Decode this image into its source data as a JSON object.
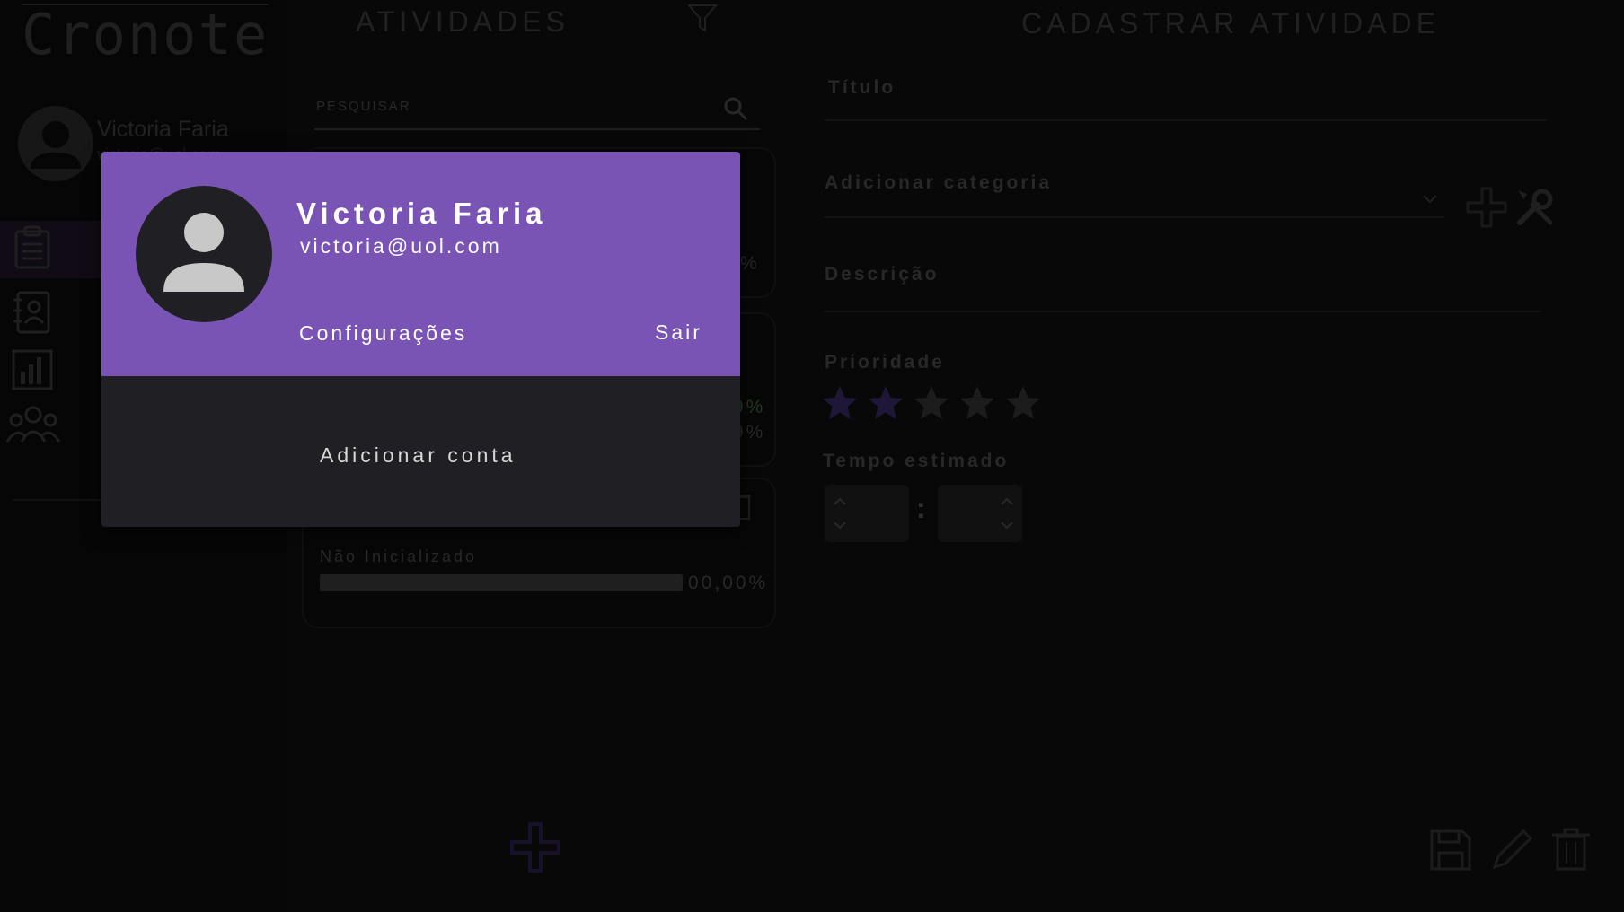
{
  "app": {
    "logo": "Cronote"
  },
  "user": {
    "name": "Victoria Faria",
    "email": "victoria@uol.com"
  },
  "sidebar": {
    "user_name": "Victoria Faria",
    "user_email": "victoria@uol.com",
    "nav": [
      {
        "icon": "clipboard-icon",
        "active": true
      },
      {
        "icon": "contacts-book-icon",
        "active": false
      },
      {
        "icon": "bar-chart-icon",
        "active": false
      },
      {
        "icon": "group-icon",
        "active": false
      }
    ]
  },
  "activities": {
    "title": "ATIVIDADES",
    "search_placeholder": "PESQUISAR",
    "cards": [
      {
        "percent_text": "%"
      },
      {
        "percent_text_1": "9%",
        "percent_text_2": "9%",
        "accent": "#4caf50"
      },
      {
        "status": "Não Inicializado",
        "progress_text": "00,00%",
        "progress": 0
      }
    ]
  },
  "form": {
    "title": "CADASTRAR ATIVIDADE",
    "title_label": "Título",
    "category_label": "Adicionar categoria",
    "description_label": "Descrição",
    "priority_label": "Prioridade",
    "priority_value": 2,
    "priority_max": 5,
    "time_label": "Tempo estimado",
    "time_separator": ":"
  },
  "popup": {
    "name": "Victoria Faria",
    "email": "victoria@uol.com",
    "settings_label": "Configurações",
    "logout_label": "Sair",
    "add_account_label": "Adicionar conta"
  },
  "colors": {
    "accent": "#7a54b5",
    "star_active": "#3a2a66",
    "star_inactive": "#333333"
  }
}
